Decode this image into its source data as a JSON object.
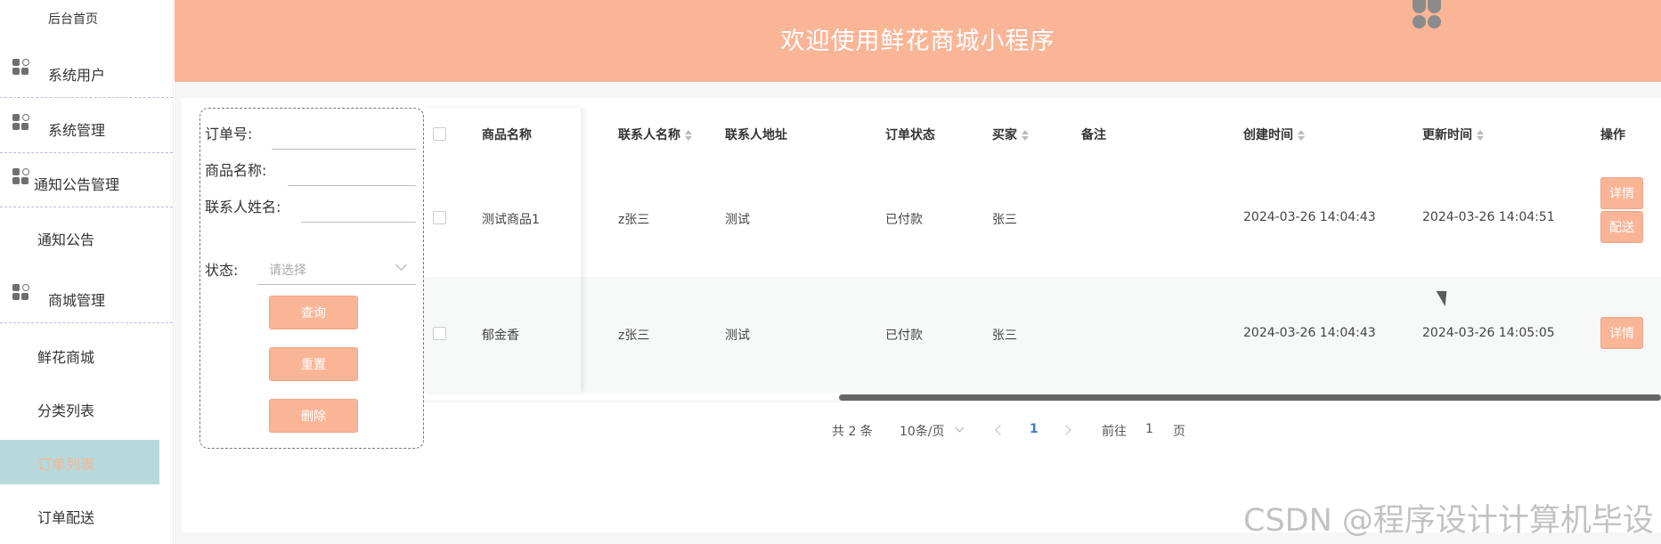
{
  "sidebar": {
    "home": "后台首页",
    "items": [
      {
        "label": "系统用户",
        "icon": "grid-icon"
      },
      {
        "label": "系统管理",
        "icon": "grid-icon"
      },
      {
        "label": "通知公告管理",
        "icon": "grid-icon"
      },
      {
        "label": "通知公告"
      },
      {
        "label": "商城管理",
        "icon": "grid-icon"
      },
      {
        "label": "鲜花商城"
      },
      {
        "label": "分类列表"
      },
      {
        "label": "订单列表",
        "active": true
      },
      {
        "label": "订单配送"
      }
    ]
  },
  "header": {
    "title": "欢迎使用鲜花商城小程序",
    "logo_icon": "logo-icon"
  },
  "search": {
    "order_no_label": "订单号:",
    "product_name_label": "商品名称:",
    "contact_name_label": "联系人姓名:",
    "status_label": "状态:",
    "status_placeholder": "请选择",
    "query_button": "查询",
    "reset_button": "重置",
    "delete_button": "删除"
  },
  "table": {
    "columns": [
      "商品名称",
      "联系人名称",
      "联系人地址",
      "订单状态",
      "买家",
      "备注",
      "创建时间",
      "更新时间",
      "操作"
    ],
    "rows": [
      {
        "product": "测试商品1",
        "contact_name": "z张三",
        "address": "测试",
        "status": "已付款",
        "buyer": "张三",
        "note": "",
        "created": "2024-03-26 14:04:43",
        "updated": "2024-03-26 14:04:51",
        "actions": [
          "详情",
          "配送"
        ]
      },
      {
        "product": "郁金香",
        "contact_name": "z张三",
        "address": "测试",
        "status": "已付款",
        "buyer": "张三",
        "note": "",
        "created": "2024-03-26 14:04:43",
        "updated": "2024-03-26 14:05:05",
        "actions": [
          "详情"
        ]
      }
    ]
  },
  "pagination": {
    "total": "共 2 条",
    "page_size": "10条/页",
    "current_page": "1",
    "goto_label": "前往",
    "goto_value": "1",
    "page_suffix": "页"
  },
  "watermark": "CSDN @程序设计计算机毕设",
  "colors": {
    "accent": "#fab597",
    "active_bg": "#b7d9db",
    "page_bg": "#f6f6f6"
  }
}
